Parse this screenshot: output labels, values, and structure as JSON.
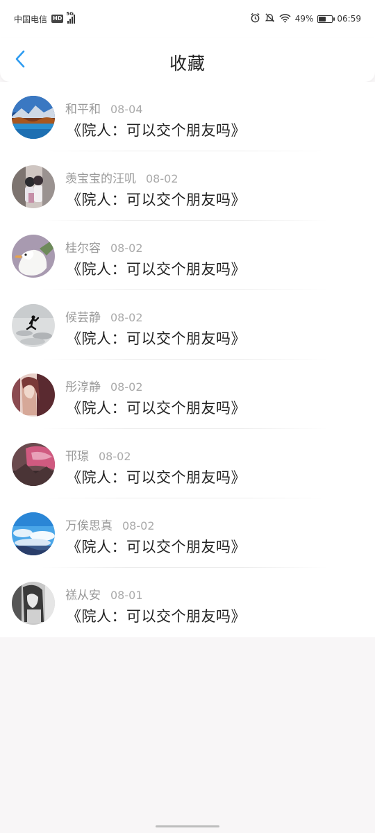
{
  "status_bar": {
    "carrier": "中国电信",
    "hd": "HD",
    "network": "5G",
    "battery_text": "49%",
    "battery_level": 0.49,
    "time": "06:59",
    "icons": [
      "alarm-icon",
      "bell-off-icon",
      "wifi-icon",
      "battery-icon",
      "signal-icon"
    ]
  },
  "header": {
    "title": "收藏",
    "back_icon": "chevron-left-icon",
    "accent": "#2d9bf0"
  },
  "favorites": [
    {
      "name": "和平和",
      "date": "08-04",
      "content": "《院人：可以交个朋友吗》",
      "avatar": "lake-landscape-avatar"
    },
    {
      "name": "羡宝宝的汪叽",
      "date": "08-02",
      "content": "《院人：可以交个朋友吗》",
      "avatar": "anime-couple-avatar"
    },
    {
      "name": "桂尔容",
      "date": "08-02",
      "content": "《院人：可以交个朋友吗》",
      "avatar": "goose-avatar"
    },
    {
      "name": "候芸静",
      "date": "08-02",
      "content": "《院人：可以交个朋友吗》",
      "avatar": "jumping-figure-avatar"
    },
    {
      "name": "彤淳静",
      "date": "08-02",
      "content": "《院人：可以交个朋友吗》",
      "avatar": "girl-portrait-avatar"
    },
    {
      "name": "邗璟",
      "date": "08-02",
      "content": "《院人：可以交个朋友吗》",
      "avatar": "pink-sky-avatar"
    },
    {
      "name": "万俟思真",
      "date": "08-02",
      "content": "《院人：可以交个朋友吗》",
      "avatar": "blue-clouds-avatar"
    },
    {
      "name": "禚从安",
      "date": "08-01",
      "content": "《院人：可以交个朋友吗》",
      "avatar": "bw-girl-avatar"
    }
  ]
}
